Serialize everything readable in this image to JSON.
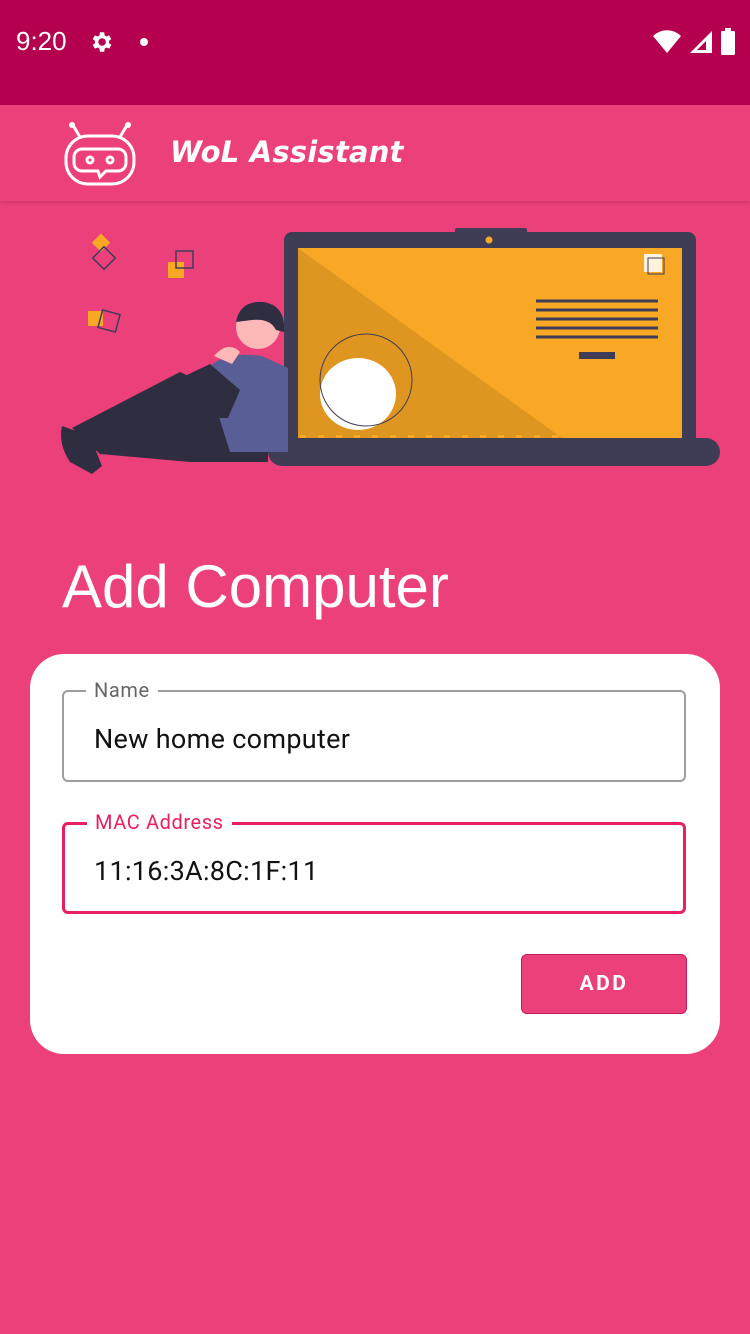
{
  "status_bar": {
    "time": "9:20",
    "icons": [
      "gear-icon",
      "notification-dot",
      "wifi-icon",
      "signal-icon",
      "battery-icon"
    ]
  },
  "app_bar": {
    "title": "WoL Assistant",
    "logo_icon": "robot-chat-icon"
  },
  "hero": {
    "illustration": "person-leaning-on-laptop"
  },
  "page": {
    "title": "Add Computer"
  },
  "form": {
    "name_label": "Name",
    "name_value": "New home computer",
    "mac_label": "MAC Address",
    "mac_value": "11:16:3A:8C:1F:11",
    "add_label": "ADD"
  },
  "colors": {
    "background": "#EC407A",
    "status_bar": "#B4004E",
    "accent": "#E91E63",
    "card": "#FFFFFF",
    "laptop_screen": "#F9A825",
    "laptop_frame": "#3F3D56"
  }
}
